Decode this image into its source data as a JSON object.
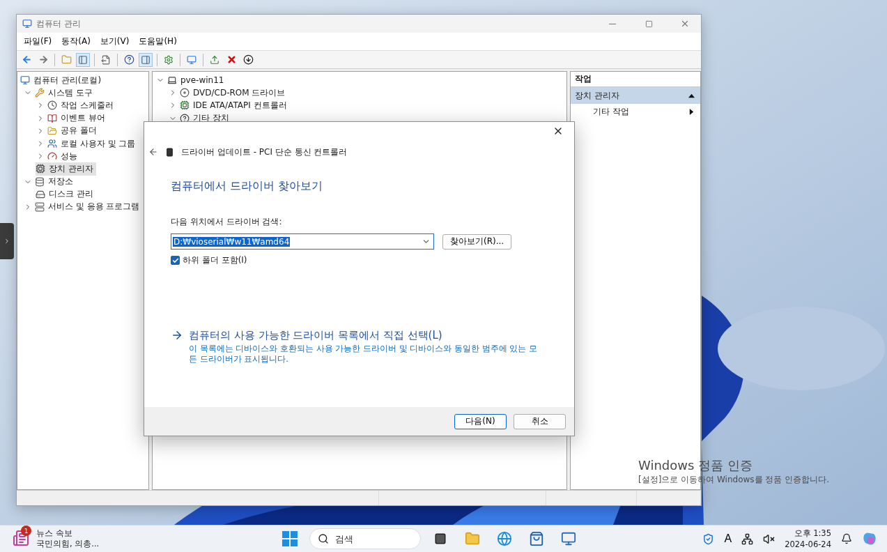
{
  "window": {
    "title": "컴퓨터 관리",
    "menu": [
      "파일(F)",
      "동작(A)",
      "보기(V)",
      "도움말(H)"
    ]
  },
  "console_tree": [
    {
      "label": "컴퓨터 관리(로컬)",
      "kind": "root",
      "selected": false,
      "children": [
        {
          "label": "시스템 도구",
          "kind": "branch",
          "expanded": true,
          "selected": false,
          "children": [
            {
              "label": "작업 스케줄러",
              "kind": "branch",
              "expanded": false,
              "selected": false
            },
            {
              "label": "이벤트 뷰어",
              "kind": "branch",
              "expanded": false,
              "selected": false
            },
            {
              "label": "공유 폴더",
              "kind": "branch",
              "expanded": false,
              "selected": false
            },
            {
              "label": "로컬 사용자 및 그룹",
              "kind": "branch",
              "expanded": false,
              "selected": false
            },
            {
              "label": "성능",
              "kind": "branch",
              "expanded": false,
              "selected": false
            },
            {
              "label": "장치 관리자",
              "kind": "leaf",
              "selected": true
            }
          ]
        },
        {
          "label": "저장소",
          "kind": "branch",
          "expanded": true,
          "selected": false,
          "children": [
            {
              "label": "디스크 관리",
              "kind": "leaf",
              "selected": false
            }
          ]
        },
        {
          "label": "서비스 및 응용 프로그램",
          "kind": "branch",
          "expanded": false,
          "selected": false
        }
      ]
    }
  ],
  "device_tree": [
    {
      "label": "pve-win11",
      "kind": "branch",
      "expanded": true,
      "selected": false,
      "children": [
        {
          "label": "DVD/CD-ROM 드라이브",
          "kind": "branch",
          "expanded": false,
          "selected": false
        },
        {
          "label": "IDE ATA/ATAPI 컨트롤러",
          "kind": "branch",
          "expanded": false,
          "selected": false
        },
        {
          "label": "기타 장치",
          "kind": "branch",
          "expanded": true,
          "selected": false
        }
      ]
    }
  ],
  "actions": {
    "title": "작업",
    "section": {
      "label": "장치 관리자",
      "expanded": true,
      "items": [
        "기타 작업"
      ]
    }
  },
  "dialog": {
    "title": "드라이버 업데이트 - PCI 단순 통신 컨트롤러",
    "heading": "컴퓨터에서 드라이버 찾아보기",
    "path_label": "다음 위치에서 드라이버 검색:",
    "path_value": "D:₩vioserial₩w11₩amd64",
    "path_value_selected": true,
    "browse_button": "찾아보기(R)...",
    "subfolders": {
      "label": "하위 폴더 포함(I)",
      "checked": true
    },
    "pick_link": "컴퓨터의 사용 가능한 드라이버 목록에서 직접 선택(L)",
    "pick_description": "이 목록에는 디바이스와 호환되는 사용 가능한 드라이버 및 디바이스와 동일한 범주에 있는 모든 드라이버가 표시됩니다.",
    "next_button": "다음(N)",
    "cancel_button": "취소"
  },
  "activation_notice": {
    "title": "Windows 정품 인증",
    "message": "[설정]으로 이동하여 Windows를 정품 인증합니다."
  },
  "taskbar": {
    "news": {
      "badge": "1",
      "title": "뉴스 속보",
      "headline": "국민의힘, 의총..."
    },
    "search": {
      "placeholder": "검색"
    },
    "ime": "A",
    "time": "오후 1:35",
    "date": "2024-06-24"
  }
}
